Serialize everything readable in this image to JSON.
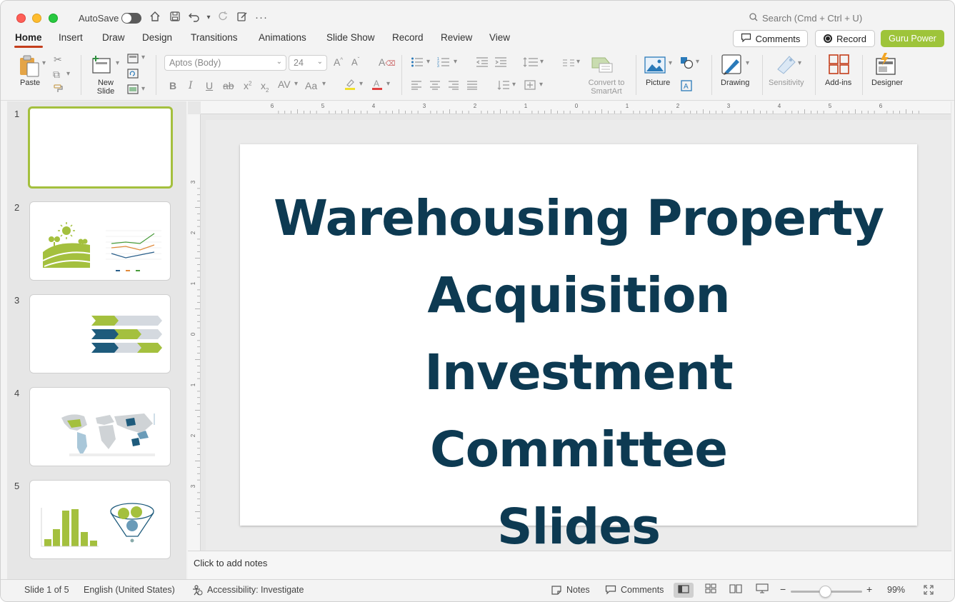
{
  "titlebar": {
    "autosave_label": "AutoSave",
    "search_placeholder": "Search (Cmd + Ctrl + U)"
  },
  "tabs": [
    {
      "label": "Home"
    },
    {
      "label": "Insert"
    },
    {
      "label": "Draw"
    },
    {
      "label": "Design"
    },
    {
      "label": "Transitions"
    },
    {
      "label": "Animations"
    },
    {
      "label": "Slide Show"
    },
    {
      "label": "Record"
    },
    {
      "label": "Review"
    },
    {
      "label": "View"
    }
  ],
  "header_buttons": {
    "comments": "Comments",
    "record": "Record",
    "guru": "Guru Power"
  },
  "ribbon": {
    "paste": "Paste",
    "new_slide": "New Slide",
    "font_name": "Aptos (Body)",
    "font_size": "24",
    "convert_smartart": "Convert to SmartArt",
    "picture": "Picture",
    "drawing": "Drawing",
    "sensitivity": "Sensitivity",
    "addins": "Add-ins",
    "designer": "Designer"
  },
  "thumbnails": [
    {
      "number": "1"
    },
    {
      "number": "2"
    },
    {
      "number": "3"
    },
    {
      "number": "4"
    },
    {
      "number": "5"
    }
  ],
  "ruler": {
    "top_ticks": [
      "6",
      "5",
      "4",
      "3",
      "2",
      "1",
      "0",
      "1",
      "2",
      "3",
      "4",
      "5",
      "6"
    ],
    "left_ticks": [
      "3",
      "2",
      "1",
      "0",
      "1",
      "2",
      "3"
    ]
  },
  "slide": {
    "title_lines": [
      "Warehousing Property",
      "Acquisition",
      "Investment Committee",
      "Slides"
    ],
    "title_color": "#0d3a52"
  },
  "notes": {
    "placeholder": "Click to add notes"
  },
  "status": {
    "slide_count": "Slide 1 of 5",
    "language": "English (United States)",
    "accessibility": "Accessibility: Investigate",
    "notes": "Notes",
    "comments": "Comments",
    "zoom": "99%"
  },
  "colors": {
    "accent": "#c43e1c",
    "guru_green": "#9ec43a",
    "thumb_green": "#a4c03e",
    "navy": "#1e5b7c"
  }
}
